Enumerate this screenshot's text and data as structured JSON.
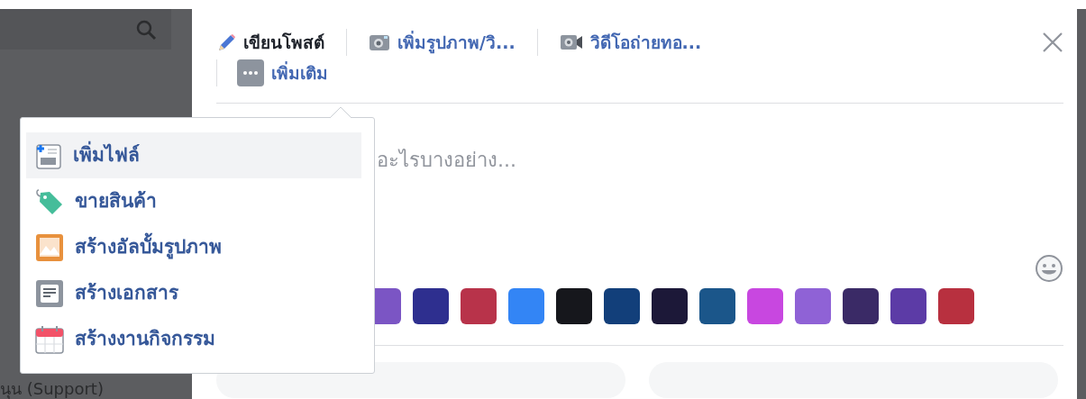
{
  "sidebar": {
    "search": {
      "kind": "search"
    },
    "items": [
      "นุน (Support)"
    ]
  },
  "composer": {
    "tabs": [
      {
        "label": "เขียนโพสต์",
        "kind": "pencil",
        "selected": true
      },
      {
        "label": "เพิ่มรูปภาพ/วิ...",
        "kind": "camera",
        "selected": false
      },
      {
        "label": "วิดีโอถ่ายทอ...",
        "kind": "video",
        "selected": false
      },
      {
        "label": "เพิ่มเติม",
        "kind": "more",
        "selected": false
      }
    ],
    "placeholder": "อะไรบางอย่าง...",
    "backgrounds": [
      {
        "color": "#7b55c4"
      },
      {
        "color": "#2e2f8f"
      },
      {
        "color": "#b8334a"
      },
      {
        "color": "#3385f5"
      },
      {
        "color": "#16171c"
      },
      {
        "color": "#123f7a"
      },
      {
        "color": "#1c1838"
      },
      {
        "color": "#1b568a"
      },
      {
        "color": "#c847e0"
      },
      {
        "color": "#8f62d6"
      },
      {
        "color": "#3a2a66"
      },
      {
        "color": "#5c3ba6"
      },
      {
        "color": "#b8303f"
      }
    ]
  },
  "menu": {
    "items": [
      {
        "label": "เพิ่มไฟล์",
        "kind": "file",
        "selected": true
      },
      {
        "label": "ขายสินค้า",
        "kind": "tag",
        "selected": false
      },
      {
        "label": "สร้างอัลบั้มรูปภาพ",
        "kind": "album",
        "selected": false
      },
      {
        "label": "สร้างเอกสาร",
        "kind": "doc",
        "selected": false
      },
      {
        "label": "สร้างงานกิจกรรม",
        "kind": "event",
        "selected": false
      }
    ]
  }
}
